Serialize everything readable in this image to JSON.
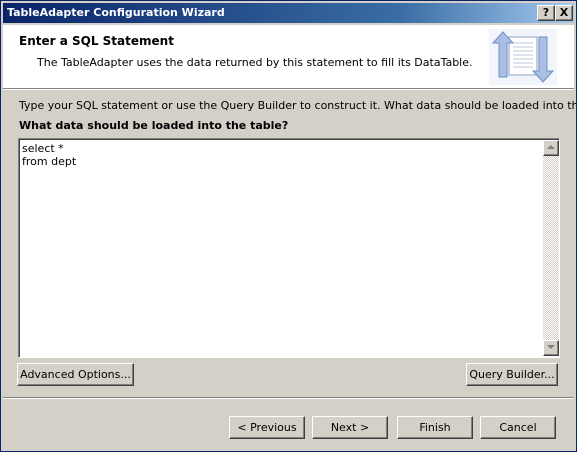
{
  "window": {
    "title": "TableAdapter Configuration Wizard",
    "help_label": "?",
    "close_label": "X"
  },
  "header": {
    "title": "Enter a SQL Statement",
    "description": "The TableAdapter uses the data returned by this statement to fill its DataTable."
  },
  "body": {
    "instruction": "Type your SQL statement or use the Query Builder to construct it. What data should be loaded into the table?",
    "question": "What data should be loaded into the table?",
    "sql_text": "select *\nfrom dept"
  },
  "buttons": {
    "advanced_options": "Advanced Options...",
    "query_builder": "Query Builder...",
    "previous": "< Previous",
    "next": "Next >",
    "finish": "Finish",
    "cancel": "Cancel"
  },
  "colors": {
    "titlebar": "#0a246a",
    "face": "#d4d0c8",
    "header_background": "#ffffff"
  },
  "icons": {
    "header": "database-sync-icon",
    "scroll_up": "arrow-up-icon",
    "scroll_down": "arrow-down-icon"
  }
}
